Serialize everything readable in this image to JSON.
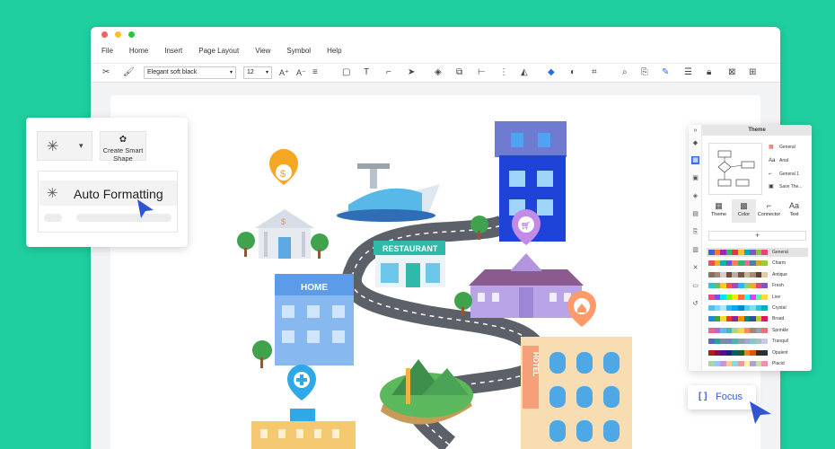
{
  "window": {
    "controls": [
      {
        "name": "close",
        "color": "#ff5f57"
      },
      {
        "name": "minimize",
        "color": "#febc2e"
      },
      {
        "name": "maximize",
        "color": "#28c840"
      }
    ]
  },
  "menu": [
    "File",
    "Home",
    "Insert",
    "Page Layout",
    "View",
    "Symbol",
    "Help"
  ],
  "toolbar": {
    "font_family": "Elegant soft black",
    "font_size": "12"
  },
  "auto_formatting_panel": {
    "create_smart_shape_label": "Create Smart Shape",
    "auto_formatting_label": "Auto Formatting"
  },
  "map": {
    "restaurant_label": "RESTAURANT",
    "home_label": "HOME",
    "hotel_label": "HOTEL"
  },
  "theme_panel": {
    "title": "Theme",
    "options": [
      {
        "icon": "grid-icon",
        "label": "General"
      },
      {
        "icon": "font-icon",
        "label": "Arial"
      },
      {
        "icon": "connector-icon",
        "label": "General 1"
      },
      {
        "icon": "save-icon",
        "label": "Save The..."
      }
    ],
    "tabs": [
      {
        "icon": "grid-icon",
        "label": "Theme"
      },
      {
        "icon": "palette-icon",
        "label": "Color",
        "active": true
      },
      {
        "icon": "connector-icon",
        "label": "Connector"
      },
      {
        "icon": "text-icon",
        "label": "Text"
      }
    ],
    "add_symbol": "+",
    "color_themes": [
      {
        "name": "General",
        "selected": true,
        "colors": [
          "#3b62d9",
          "#f57a2c",
          "#9c27b0",
          "#2bb673",
          "#e53935",
          "#fbc02d",
          "#00acc1",
          "#7e57c2",
          "#8bc34a",
          "#ec407a"
        ]
      },
      {
        "name": "Charm",
        "colors": [
          "#e8505b",
          "#f9a826",
          "#14b1ab",
          "#6a5acd",
          "#ff7f50",
          "#3cb371",
          "#db7093",
          "#4682b4",
          "#daa520",
          "#9acd32"
        ]
      },
      {
        "name": "Antique",
        "colors": [
          "#8d6e63",
          "#a1887f",
          "#d7ccc8",
          "#6d4c41",
          "#bcaaa4",
          "#795548",
          "#c8b79e",
          "#a58c6f",
          "#5d4037",
          "#e0c9a6"
        ]
      },
      {
        "name": "Fresh",
        "colors": [
          "#26c6da",
          "#66bb6a",
          "#ffca28",
          "#ef5350",
          "#ab47bc",
          "#29b6f6",
          "#9ccc65",
          "#ffa726",
          "#ec407a",
          "#7e57c2"
        ]
      },
      {
        "name": "Live",
        "colors": [
          "#ff4081",
          "#7c4dff",
          "#00e5ff",
          "#76ff03",
          "#ffea00",
          "#ff6e40",
          "#18ffff",
          "#e040fb",
          "#69f0ae",
          "#ffd740"
        ]
      },
      {
        "name": "Crystal",
        "colors": [
          "#4fc3f7",
          "#81d4fa",
          "#b3e5fc",
          "#29b6f6",
          "#03a9f4",
          "#0288d1",
          "#4dd0e1",
          "#80deea",
          "#26c6da",
          "#00acc1"
        ]
      },
      {
        "name": "Broad",
        "colors": [
          "#1e88e5",
          "#43a047",
          "#fdd835",
          "#e53935",
          "#8e24aa",
          "#fb8c00",
          "#00897b",
          "#3949ab",
          "#c0ca33",
          "#d81b60"
        ]
      },
      {
        "name": "Sprinkle",
        "colors": [
          "#f06292",
          "#ba68c8",
          "#64b5f6",
          "#4db6ac",
          "#aed581",
          "#ffd54f",
          "#ff8a65",
          "#a1887f",
          "#90a4ae",
          "#e57373"
        ]
      },
      {
        "name": "Tranquil",
        "colors": [
          "#5c6bc0",
          "#26a69a",
          "#78909c",
          "#7986cb",
          "#4db6ac",
          "#90a4ae",
          "#9fa8da",
          "#80cbc4",
          "#b0bec5",
          "#c5cae9"
        ]
      },
      {
        "name": "Opulent",
        "colors": [
          "#b71c1c",
          "#880e4f",
          "#4a148c",
          "#1a237e",
          "#006064",
          "#1b5e20",
          "#f57f17",
          "#e65100",
          "#3e2723",
          "#263238"
        ]
      },
      {
        "name": "Placid",
        "colors": [
          "#a5d6a7",
          "#90caf9",
          "#ce93d8",
          "#ffcc80",
          "#80deea",
          "#ef9a9a",
          "#fff59d",
          "#b39ddb",
          "#c5e1a5",
          "#f48fb1"
        ]
      }
    ]
  },
  "focus": {
    "label": "Focus"
  },
  "colors": {
    "background": "#1fcf9f",
    "accent": "#3a5bd9",
    "road": "#5c6068"
  }
}
